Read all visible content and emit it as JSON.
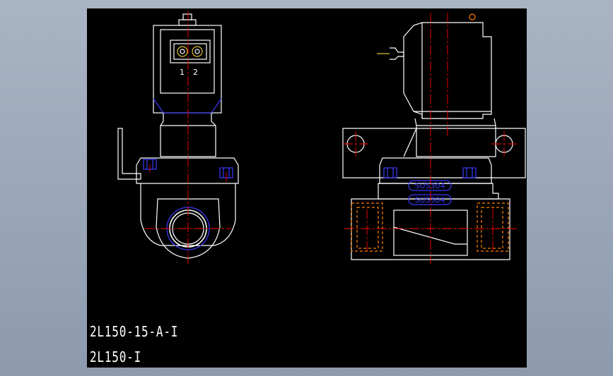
{
  "colors": {
    "background": "#000000",
    "outline": "#ffffff",
    "centerline": "#ff0000",
    "hidden": "#ff8000",
    "blue": "#3a3aff",
    "yellow": "#e0c030"
  },
  "connector": {
    "pin1": "1",
    "pin2": "2"
  },
  "body": {
    "stamp1": "SUS304",
    "stamp2": "SUS304"
  },
  "labels": {
    "model": "2L150-15-A-I",
    "series": "2L150-I"
  }
}
